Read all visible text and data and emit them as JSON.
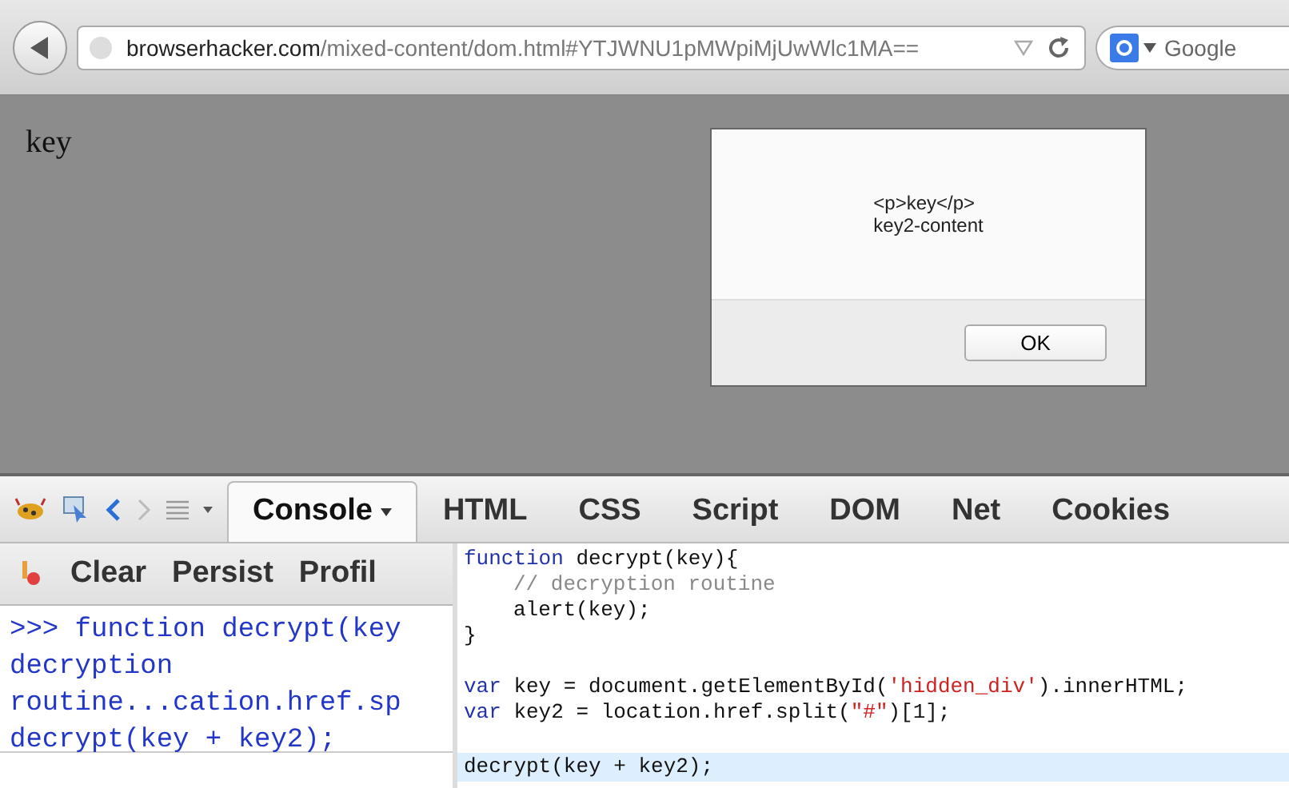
{
  "browser_toolbar": {
    "url_host": "browserhacker.com",
    "url_path": "/mixed-content/dom.html#YTJWNU1pMWpiMjUwWlc1MA==",
    "search_placeholder": "Google"
  },
  "page": {
    "text": "key"
  },
  "alert_dialog": {
    "lines": [
      "<p>key</p>",
      "key2-content"
    ],
    "button": "OK"
  },
  "devtools": {
    "tabs": [
      {
        "label": "Console",
        "selected": true
      },
      {
        "label": "HTML",
        "selected": false
      },
      {
        "label": "CSS",
        "selected": false
      },
      {
        "label": "Script",
        "selected": false
      },
      {
        "label": "DOM",
        "selected": false
      },
      {
        "label": "Net",
        "selected": false
      },
      {
        "label": "Cookies",
        "selected": false
      }
    ],
    "console_toolbar": [
      "Clear",
      "Persist",
      "Profil"
    ],
    "console_output": [
      ">>> function decrypt(key",
      "decryption",
      "routine...cation.href.sp",
      "decrypt(key + key2);"
    ],
    "editor_lines": [
      {
        "highlighted": false,
        "indented": false,
        "tokens": [
          {
            "kind": "keyword",
            "text": "function"
          },
          {
            "kind": "plain",
            "text": " decrypt(key){"
          }
        ]
      },
      {
        "highlighted": false,
        "indented": true,
        "tokens": [
          {
            "kind": "comment",
            "text": "// decryption routine"
          }
        ]
      },
      {
        "highlighted": false,
        "indented": true,
        "tokens": [
          {
            "kind": "plain",
            "text": "alert(key);"
          }
        ]
      },
      {
        "highlighted": false,
        "indented": false,
        "tokens": [
          {
            "kind": "plain",
            "text": "}"
          }
        ]
      },
      {
        "highlighted": false
      },
      {
        "highlighted": false,
        "indented": false,
        "tokens": [
          {
            "kind": "keyword",
            "text": "var"
          },
          {
            "kind": "plain",
            "text": " key = document.getElementById("
          },
          {
            "kind": "string",
            "text": "'hidden_div'"
          },
          {
            "kind": "plain",
            "text": ").innerHTML;"
          }
        ]
      },
      {
        "highlighted": false,
        "indented": false,
        "tokens": [
          {
            "kind": "keyword",
            "text": "var"
          },
          {
            "kind": "plain",
            "text": " key2 = location.href.split("
          },
          {
            "kind": "string",
            "text": "\"#\""
          },
          {
            "kind": "plain",
            "text": ")[1];"
          }
        ]
      },
      {
        "highlighted": false
      },
      {
        "highlighted": true,
        "indented": false,
        "tokens": [
          {
            "kind": "plain",
            "text": "decrypt(key + key2);"
          }
        ]
      }
    ]
  }
}
